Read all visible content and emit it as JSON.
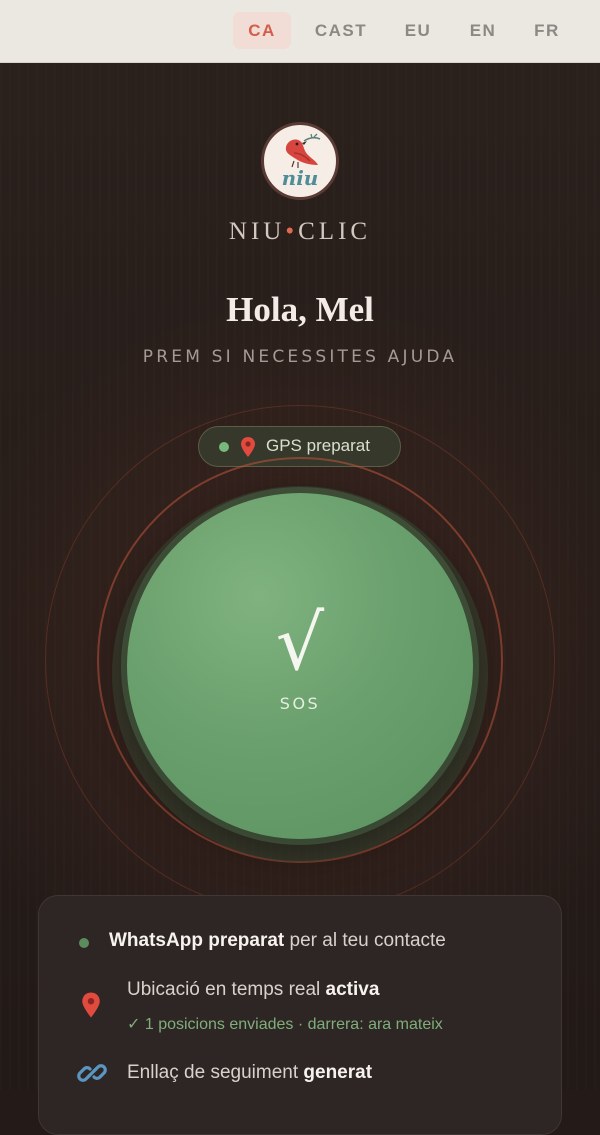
{
  "languages": [
    {
      "code": "CA",
      "active": true
    },
    {
      "code": "CAST",
      "active": false
    },
    {
      "code": "EU",
      "active": false
    },
    {
      "code": "EN",
      "active": false
    },
    {
      "code": "FR",
      "active": false
    }
  ],
  "brand": {
    "logo_text": "niu",
    "name_left": "NIU",
    "name_sep": "•",
    "name_right": "CLIC"
  },
  "greeting": "Hola, Mel",
  "subtitle": "PREM SI NECESSITES AJUDA",
  "gps": {
    "icon": "pin-icon",
    "label": "GPS preparat",
    "status_color": "#78b87a"
  },
  "sos": {
    "check": "√",
    "label": "SOS",
    "color": "#6aa06d"
  },
  "status": {
    "whatsapp": {
      "strong": "WhatsApp preparat",
      "rest": " per al teu contacte"
    },
    "location": {
      "icon": "pin-icon",
      "text": "Ubicació en temps real ",
      "strong": "activa",
      "sub": "✓ 1 posicions enviades · darrera: ara mateix"
    },
    "link": {
      "icon": "link-icon",
      "text": "Enllaç de seguiment ",
      "strong": "generat"
    }
  },
  "colors": {
    "accent": "#d25f4c",
    "background": "#241b18",
    "green": "#6aa06d"
  }
}
